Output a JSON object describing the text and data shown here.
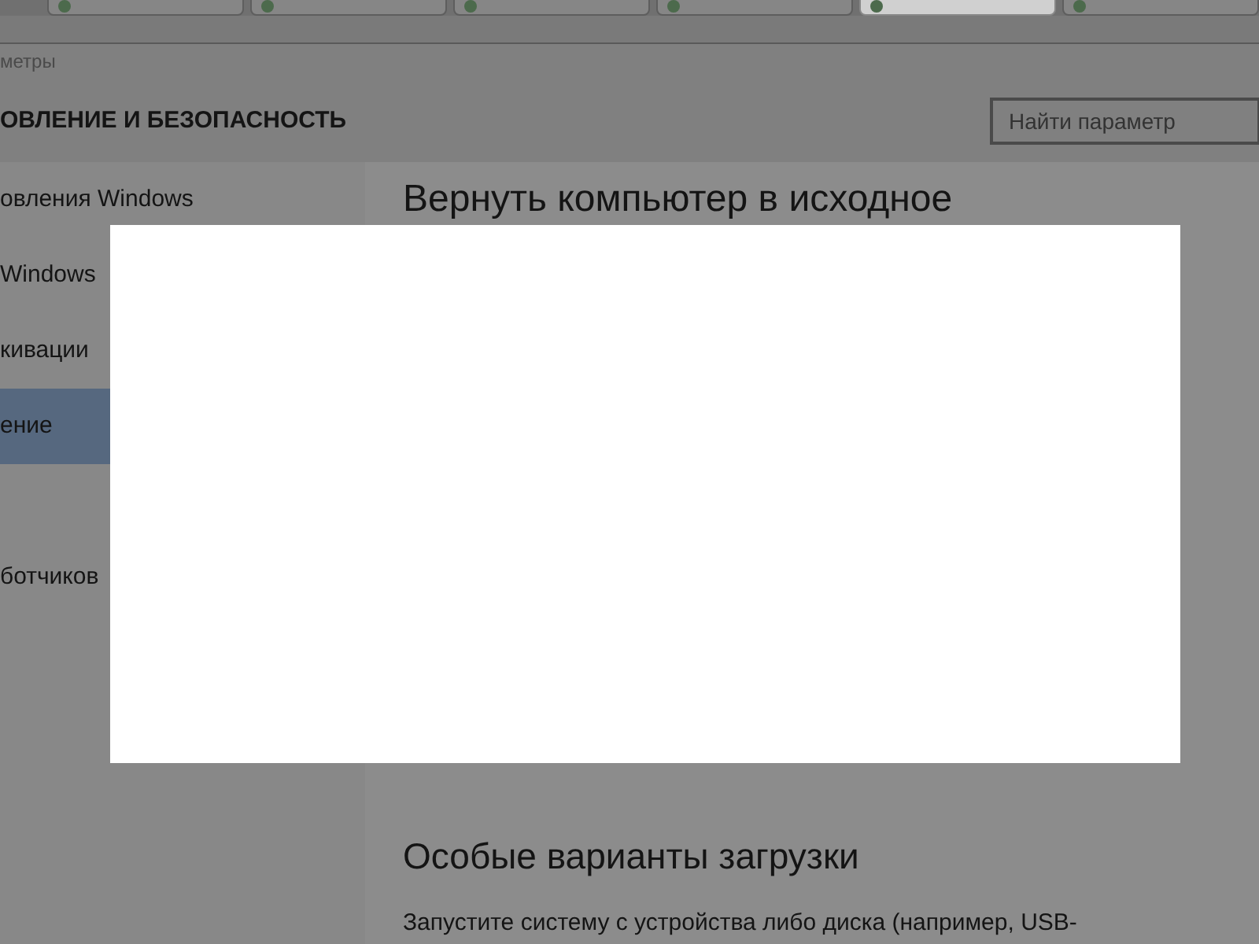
{
  "browser_tabs": [
    {
      "selected": false
    },
    {
      "selected": false
    },
    {
      "selected": false
    },
    {
      "selected": false
    },
    {
      "selected": true
    },
    {
      "selected": false
    }
  ],
  "breadcrumb": "метры",
  "header": {
    "title": "ОВЛЕНИЕ И БЕЗОПАСНОСТЬ",
    "search": {
      "placeholder": "Найти параметр"
    }
  },
  "sidebar": {
    "items": [
      {
        "label": "овления Windows",
        "selected": false
      },
      {
        "label": "Windows",
        "selected": false
      },
      {
        "label": "кивации",
        "selected": false
      },
      {
        "label": "ение",
        "selected": true
      },
      {
        "label": "ботчиков",
        "selected": false
      }
    ]
  },
  "content": {
    "heading": "Вернуть компьютер в исходное",
    "section_title": "Особые варианты загрузки",
    "section_text": "Запустите систему с устройства либо диска (например, USB-"
  }
}
